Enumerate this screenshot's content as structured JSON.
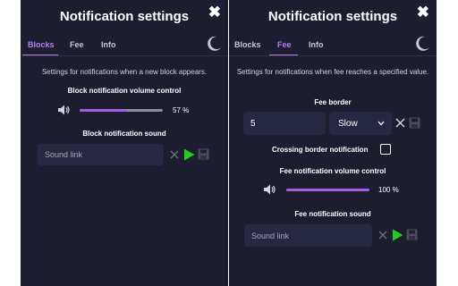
{
  "left": {
    "title": "Notification settings",
    "close": "✖",
    "tabs": [
      "Blocks",
      "Fee",
      "Info"
    ],
    "active_tab": "Blocks",
    "description": "Settings for notifications when a new block appears.",
    "volume_label": "Block notification volume control",
    "volume_percent": 57,
    "volume_text": "57 %",
    "sound_label": "Block notification sound",
    "sound_placeholder": "Sound link"
  },
  "right": {
    "title": "Notification settings",
    "close": "✖",
    "tabs": [
      "Blocks",
      "Fee",
      "Info"
    ],
    "active_tab": "Fee",
    "description": "Settings for notifications when fee reaches a specified value.",
    "fee_border_label": "Fee border",
    "fee_border_value": "5",
    "speed_selected": "Slow",
    "crossing_label": "Crossing border notification",
    "crossing_checked": false,
    "volume_label": "Fee notification volume control",
    "volume_percent": 100,
    "volume_text": "100 %",
    "sound_label": "Fee notification sound",
    "sound_placeholder": "Sound link"
  },
  "icons": {
    "speaker": "speaker-icon",
    "moon": "moon-icon",
    "clear": "x-icon",
    "play": "play-icon",
    "save": "save-icon",
    "chevron": "chevron-down-icon"
  },
  "colors": {
    "panel_bg": "#1c1d2f",
    "accent": "#b77cf0",
    "slider_fill": "#a85bdc",
    "play_green": "#22cc22"
  }
}
